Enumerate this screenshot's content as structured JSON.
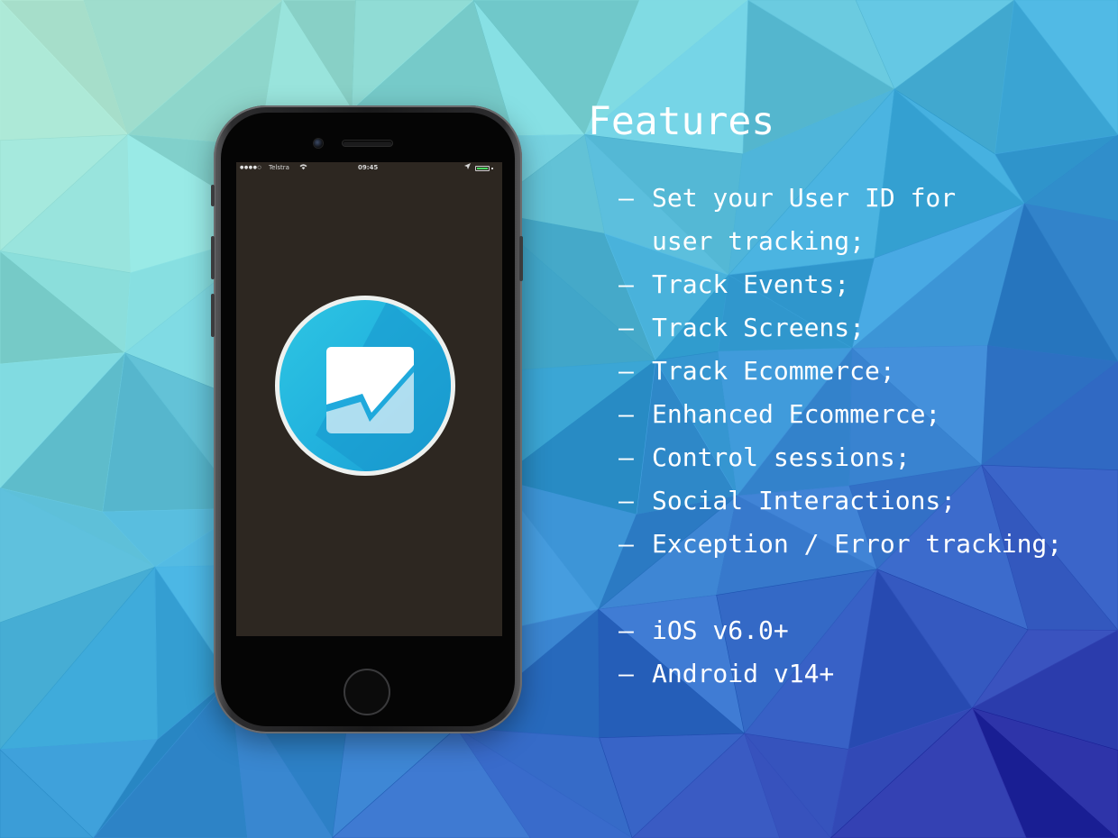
{
  "colors": {
    "background_top_left": "#b9ecd4",
    "background_mid": "#3aa2d6",
    "background_bottom_right": "#241b9a",
    "text": "#ffffff",
    "screen": "#2d2721",
    "logo_blue": "#22b3de",
    "battery_green": "#4cd964"
  },
  "phone": {
    "status_bar": {
      "signal": "●●●●○",
      "carrier": "Telstra",
      "wifi_icon": "wifi-icon",
      "time": "09:45",
      "location_icon": "location-arrow-icon",
      "battery_icon": "battery-icon"
    },
    "app_icon": "analytics-chart-logo-icon"
  },
  "features": {
    "title": "Features",
    "items": [
      [
        "Set your User ID for",
        "user tracking;"
      ],
      [
        "Track Events;"
      ],
      [
        "Track Screens;"
      ],
      [
        "Track Ecommerce;"
      ],
      [
        "Enhanced Ecommerce;"
      ],
      [
        "Control sessions;"
      ],
      [
        "Social Interactions;"
      ],
      [
        "Exception / Error tracking;"
      ]
    ],
    "bullet": "–"
  },
  "platforms": {
    "items": [
      "iOS v6.0+",
      "Android v14+"
    ]
  }
}
